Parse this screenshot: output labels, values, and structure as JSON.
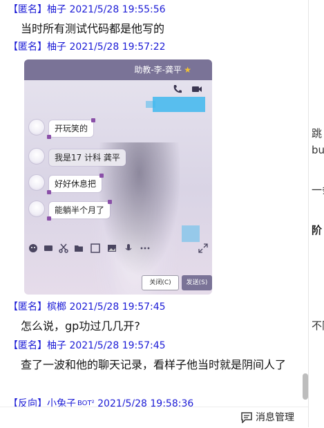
{
  "messages": [
    {
      "tag": "【匿名】",
      "sender": "柚子",
      "time": "2021/5/28 19:55:56",
      "body": "当时所有测试代码都是他写的"
    },
    {
      "tag": "【匿名】",
      "sender": "柚子",
      "time": "2021/5/28 19:57:22",
      "image": {
        "title": "助教-李-龚平",
        "bubbles": [
          "开玩笑的",
          "我是17 计科 龚平",
          "好好休息把",
          "能躺半个月了"
        ],
        "close_label": "关闭(C)",
        "send_label": "发送(S)"
      }
    },
    {
      "tag": "【匿名】",
      "sender": "槟榔",
      "time": "2021/5/28 19:57:45",
      "body": "怎么说，gp功过几几开?"
    },
    {
      "tag": "【匿名】",
      "sender": "柚子",
      "time": "2021/5/28 19:57:45",
      "body": "查了一波和他的聊天记录，看样子他当时就是阴间人了"
    },
    {
      "tag": "【反向】",
      "sender": "小兔子",
      "bot_tag": "BOT²",
      "time": "2021/5/28 19:58:36"
    }
  ],
  "right_pane": {
    "lines": [
      "跳",
      "bu",
      "一条",
      "阶",
      "不同"
    ]
  },
  "bottom_bar": {
    "message_manager_label": "消息管理"
  },
  "colors": {
    "header_blue": "#1a1ad6",
    "shot_titlebar": "#7a7397",
    "blur_blue": "#3fb8ee"
  }
}
